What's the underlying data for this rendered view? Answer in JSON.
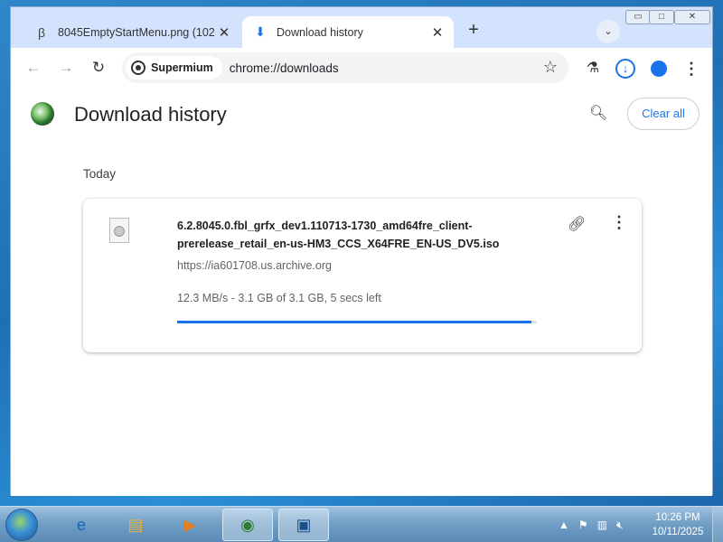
{
  "tabs": [
    {
      "title": "8045EmptyStartMenu.png (102",
      "icon": "beta-icon"
    },
    {
      "title": "Download history",
      "icon": "download-icon"
    }
  ],
  "toolbar": {
    "brand": "Supermium",
    "url": "chrome://downloads"
  },
  "page": {
    "title": "Download history",
    "clear_all": "Clear all",
    "section": "Today"
  },
  "download": {
    "filename": "6.2.8045.0.fbl_grfx_dev1.110713-1730_amd64fre_client-prerelease_retail_en-us-HM3_CCS_X64FRE_EN-US_DV5.iso",
    "url": "https://ia601708.us.archive.org",
    "status": "12.3 MB/s - 3.1 GB of 3.1 GB, 5 secs left",
    "progress": 0.985
  },
  "taskbar": {
    "time": "10:26 PM",
    "date": "10/11/2025"
  },
  "colors": {
    "accent": "#1a73e8",
    "tabstrip": "#d3e3fd"
  }
}
